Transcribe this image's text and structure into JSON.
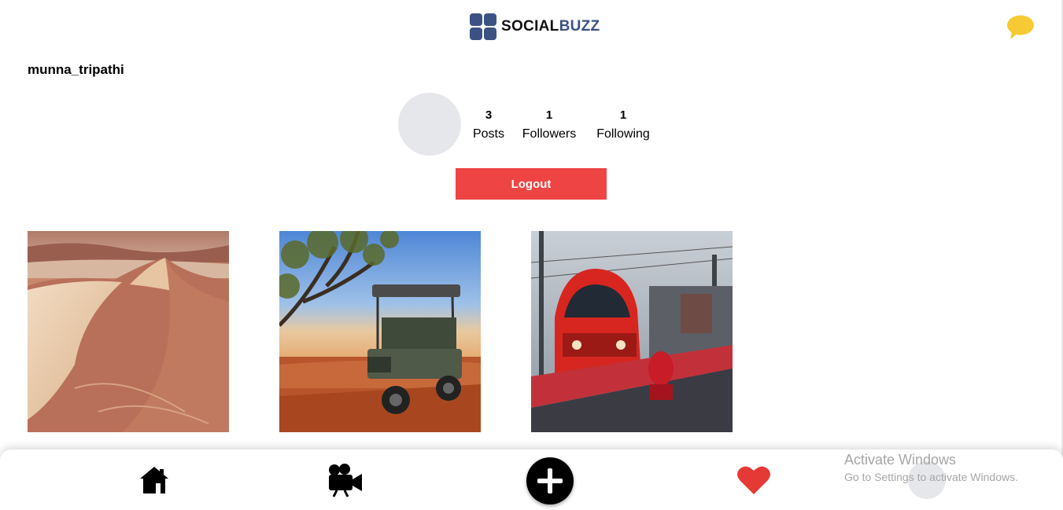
{
  "header": {
    "logo_text_primary": "SOCIAL",
    "logo_text_accent": "BUZZ",
    "logo_icon": "grid-icon",
    "chat_icon": "chat-bubble-icon"
  },
  "profile": {
    "username": "munna_tripathi",
    "stats": {
      "posts_count": "3",
      "posts_label": "Posts",
      "followers_count": "1",
      "followers_label": "Followers",
      "following_count": "1",
      "following_label": "Following"
    },
    "logout_label": "Logout"
  },
  "posts": [
    {
      "subject": "desert-dunes-photo"
    },
    {
      "subject": "safari-jeep-photo"
    },
    {
      "subject": "red-train-photo"
    }
  ],
  "bottom_nav": {
    "items": [
      "home-icon",
      "video-camera-icon",
      "add-icon",
      "heart-icon",
      "profile-avatar"
    ]
  },
  "windows_watermark": {
    "line1": "Activate Windows",
    "line2": "Go to Settings to activate Windows."
  },
  "colors": {
    "brand": "#3b5283",
    "logout": "#ef4444",
    "chat": "#f7c933",
    "heart": "#e53935",
    "avatar_placeholder": "#e5e7eb"
  }
}
